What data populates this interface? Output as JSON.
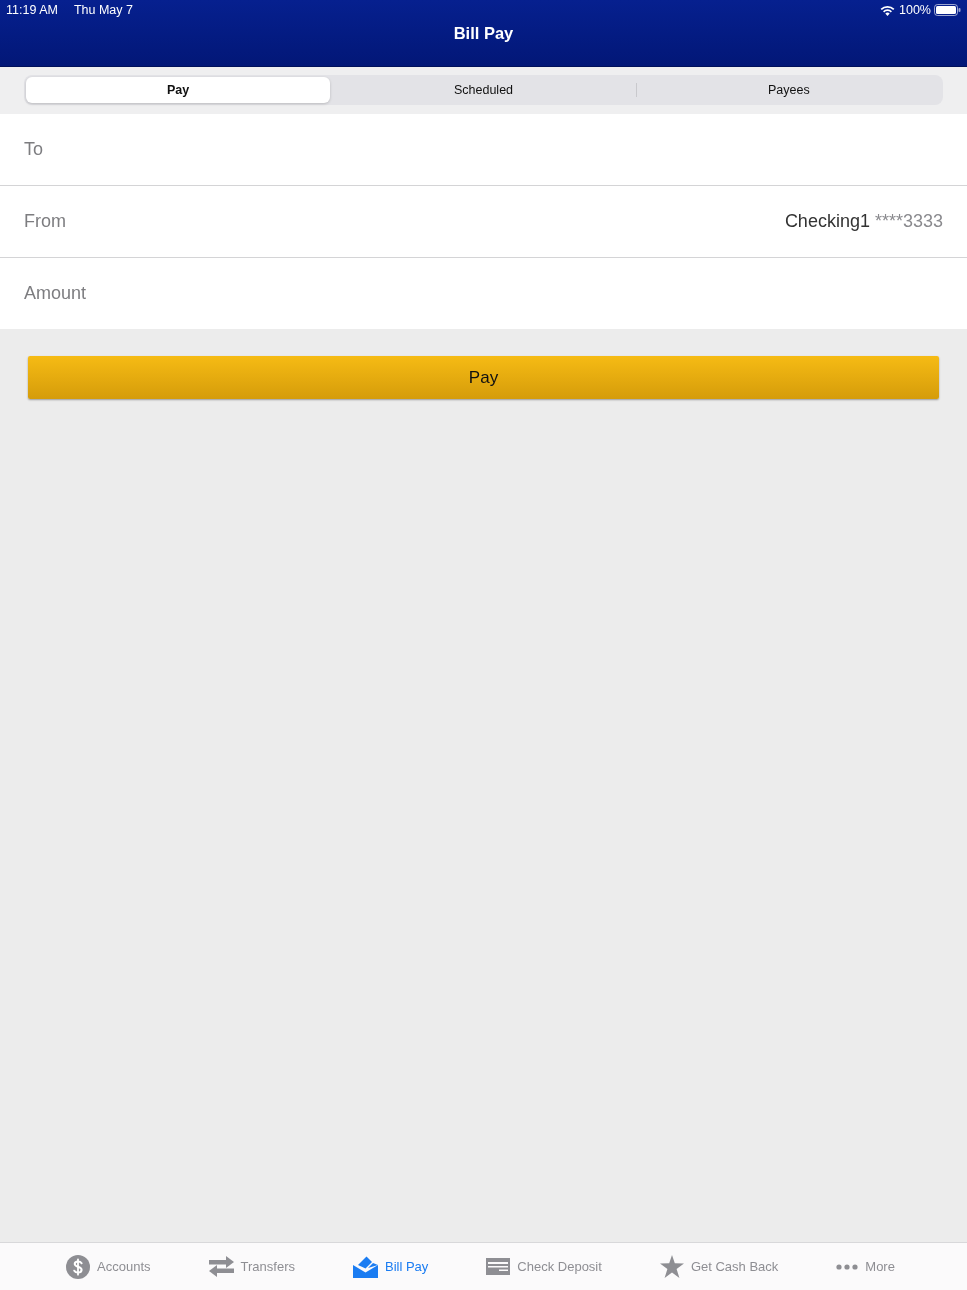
{
  "status_bar": {
    "time": "11:19 AM",
    "date": "Thu May 7",
    "battery": "100%"
  },
  "nav_bar": {
    "title": "Bill Pay"
  },
  "segments": [
    {
      "label": "Pay",
      "selected": true
    },
    {
      "label": "Scheduled",
      "selected": false
    },
    {
      "label": "Payees",
      "selected": false
    }
  ],
  "form": {
    "rows": [
      {
        "label": "To"
      },
      {
        "label": "From",
        "value": "Checking1",
        "value_detail": "****3333"
      },
      {
        "label": "Amount"
      }
    ]
  },
  "pay_button": {
    "label": "Pay"
  },
  "tab_bar": [
    {
      "kind": "accounts",
      "label": "Accounts",
      "selected": false
    },
    {
      "kind": "transfers",
      "label": "Transfers",
      "selected": false
    },
    {
      "kind": "billpay",
      "label": "Bill Pay",
      "selected": true
    },
    {
      "kind": "deposit",
      "label": "Check Deposit",
      "selected": false
    },
    {
      "kind": "cashback",
      "label": "Get Cash Back",
      "selected": false
    },
    {
      "kind": "more",
      "label": "More",
      "selected": false
    }
  ]
}
